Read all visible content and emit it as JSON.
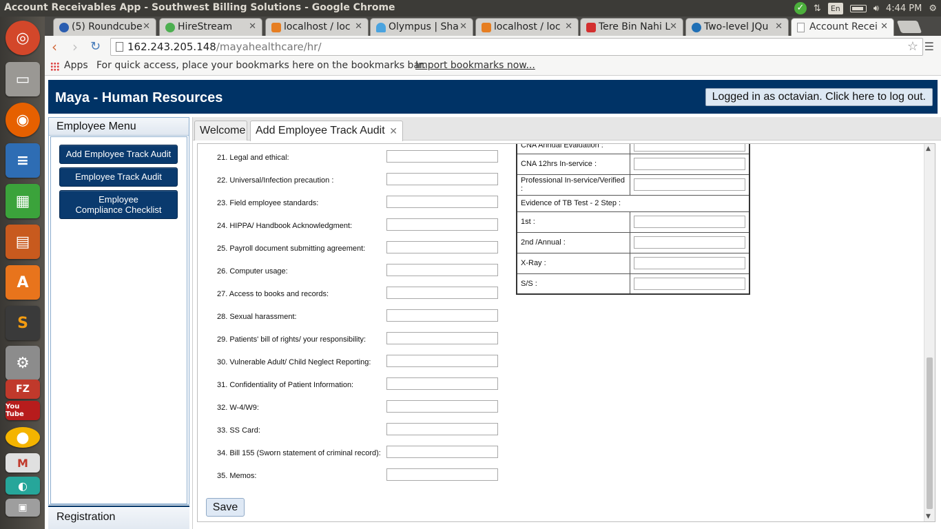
{
  "os": {
    "window_title": "Account Receivables App - Southwest Billing Solutions - Google Chrome",
    "keyboard": "En",
    "clock": "4:44 PM"
  },
  "browser": {
    "tabs": [
      {
        "label": "(5) Roundcube",
        "favicon_color": "#2a5db0"
      },
      {
        "label": "HireStream",
        "favicon_color": "#4caf50"
      },
      {
        "label": "localhost / loc",
        "favicon_color": "#e67e22"
      },
      {
        "label": "Olympus | Sha",
        "favicon_color": "#4aa3df"
      },
      {
        "label": "localhost / loc",
        "favicon_color": "#e67e22"
      },
      {
        "label": "Tere Bin Nahi L",
        "favicon_color": "#d32f2f"
      },
      {
        "label": "Two-level JQu",
        "favicon_color": "#1f6fb5"
      },
      {
        "label": "Account Recei",
        "favicon_color": "#ffffff"
      }
    ],
    "url_host": "162.243.205.148",
    "url_path": "/mayahealthcare/hr/",
    "bookmarks": {
      "apps": "Apps",
      "hint": "For quick access, place your bookmarks here on the bookmarks bar.",
      "import": "Import bookmarks now..."
    }
  },
  "app": {
    "title": "Maya - Human Resources",
    "logout": "Logged in as octavian. Click here to log out.",
    "menu": {
      "heading": "Employee Menu",
      "buttons": [
        "Add Employee Track Audit",
        "Employee Track Audit",
        "Employee\nCompliance Checklist"
      ],
      "registration": "Registration"
    },
    "tabs": {
      "welcome": "Welcome",
      "active": "Add Employee Track Audit"
    },
    "form_items": [
      "21. Legal and ethical:",
      "22. Universal/Infection precaution :",
      "23. Field employee standards:",
      "24. HIPPA/ Handbook Acknowledgment:",
      "25. Payroll document submitting agreement:",
      "26. Computer usage:",
      "27. Access to books and records:",
      "28. Sexual harassment:",
      "29. Patients' bill of rights/ your responsibility:",
      "30. Vulnerable Adult/ Child Neglect Reporting:",
      "31. Confidentiality of Patient Information:",
      "32. W-4/W9:",
      "33. SS Card:",
      "34. Bill 155 (Sworn statement of criminal record):",
      "35. Memos:"
    ],
    "right_table": {
      "rows": [
        "CNA Annual Evaluation :",
        "CNA 12hrs In-service :",
        "Professional In-service/Verified :"
      ],
      "tb_heading": "Evidence of TB Test - 2 Step :",
      "tb_rows": [
        "1st :",
        "2nd /Annual :",
        "X-Ray :",
        "S/S :"
      ]
    },
    "save": "Save"
  }
}
